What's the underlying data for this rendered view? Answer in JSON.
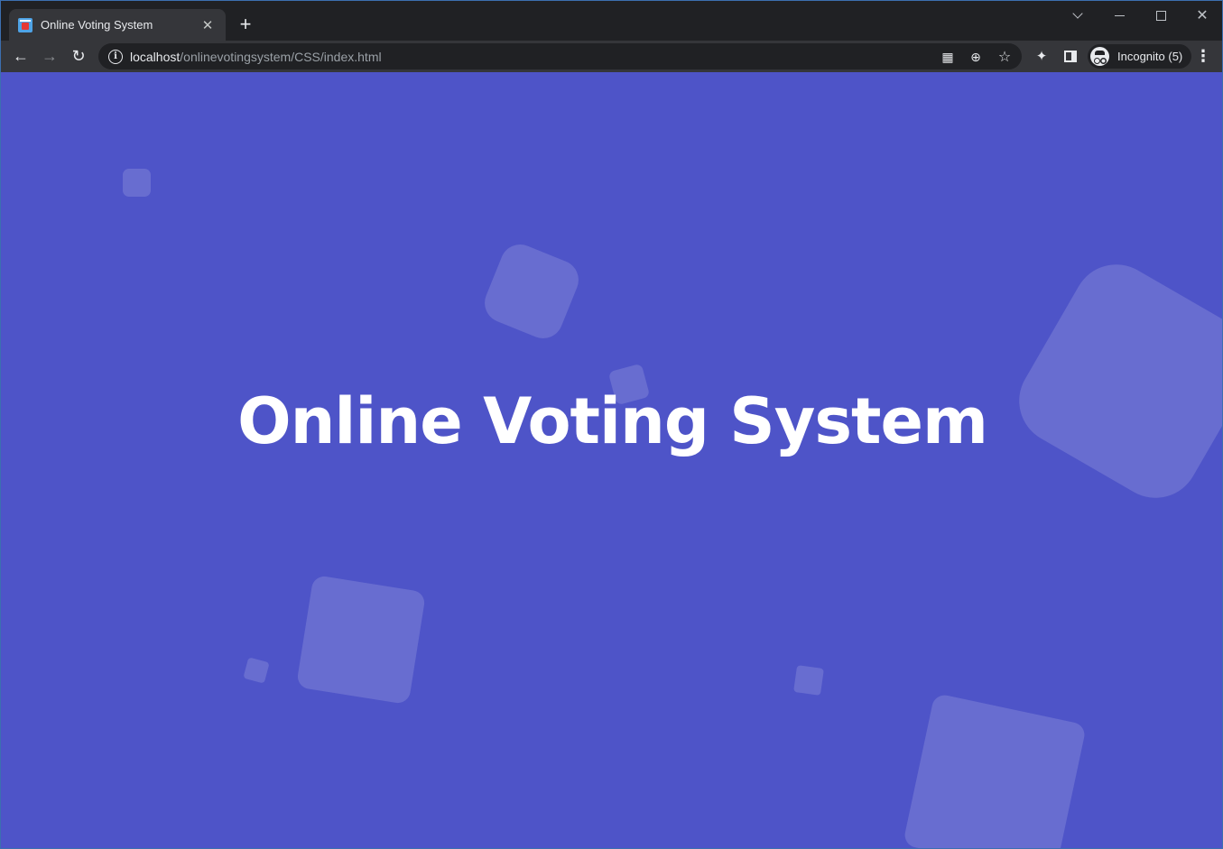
{
  "browser": {
    "tab": {
      "title": "Online Voting System",
      "close_glyph": "✕",
      "favicon": "ballot-box-icon"
    },
    "new_tab_glyph": "+",
    "window_controls": {
      "tab_search": "chevron-down-icon",
      "minimize": "minimize-icon",
      "maximize": "maximize-icon",
      "close_glyph": "✕"
    },
    "toolbar": {
      "back_glyph": "←",
      "forward_glyph": "→",
      "reload_glyph": "↻",
      "site_info_glyph": "i",
      "url_host": "localhost",
      "url_path": "/onlinevotingsystem/CSS/index.html",
      "qr_glyph": "▦",
      "zoom_glyph": "⊕",
      "star_glyph": "☆",
      "extensions_glyph": "✦",
      "profile_label": "Incognito (5)",
      "menu_glyph": "⋮"
    }
  },
  "page": {
    "title": "Online Voting System",
    "background_color": "#4e54c8",
    "decoration": "floating-translucent-squares"
  }
}
